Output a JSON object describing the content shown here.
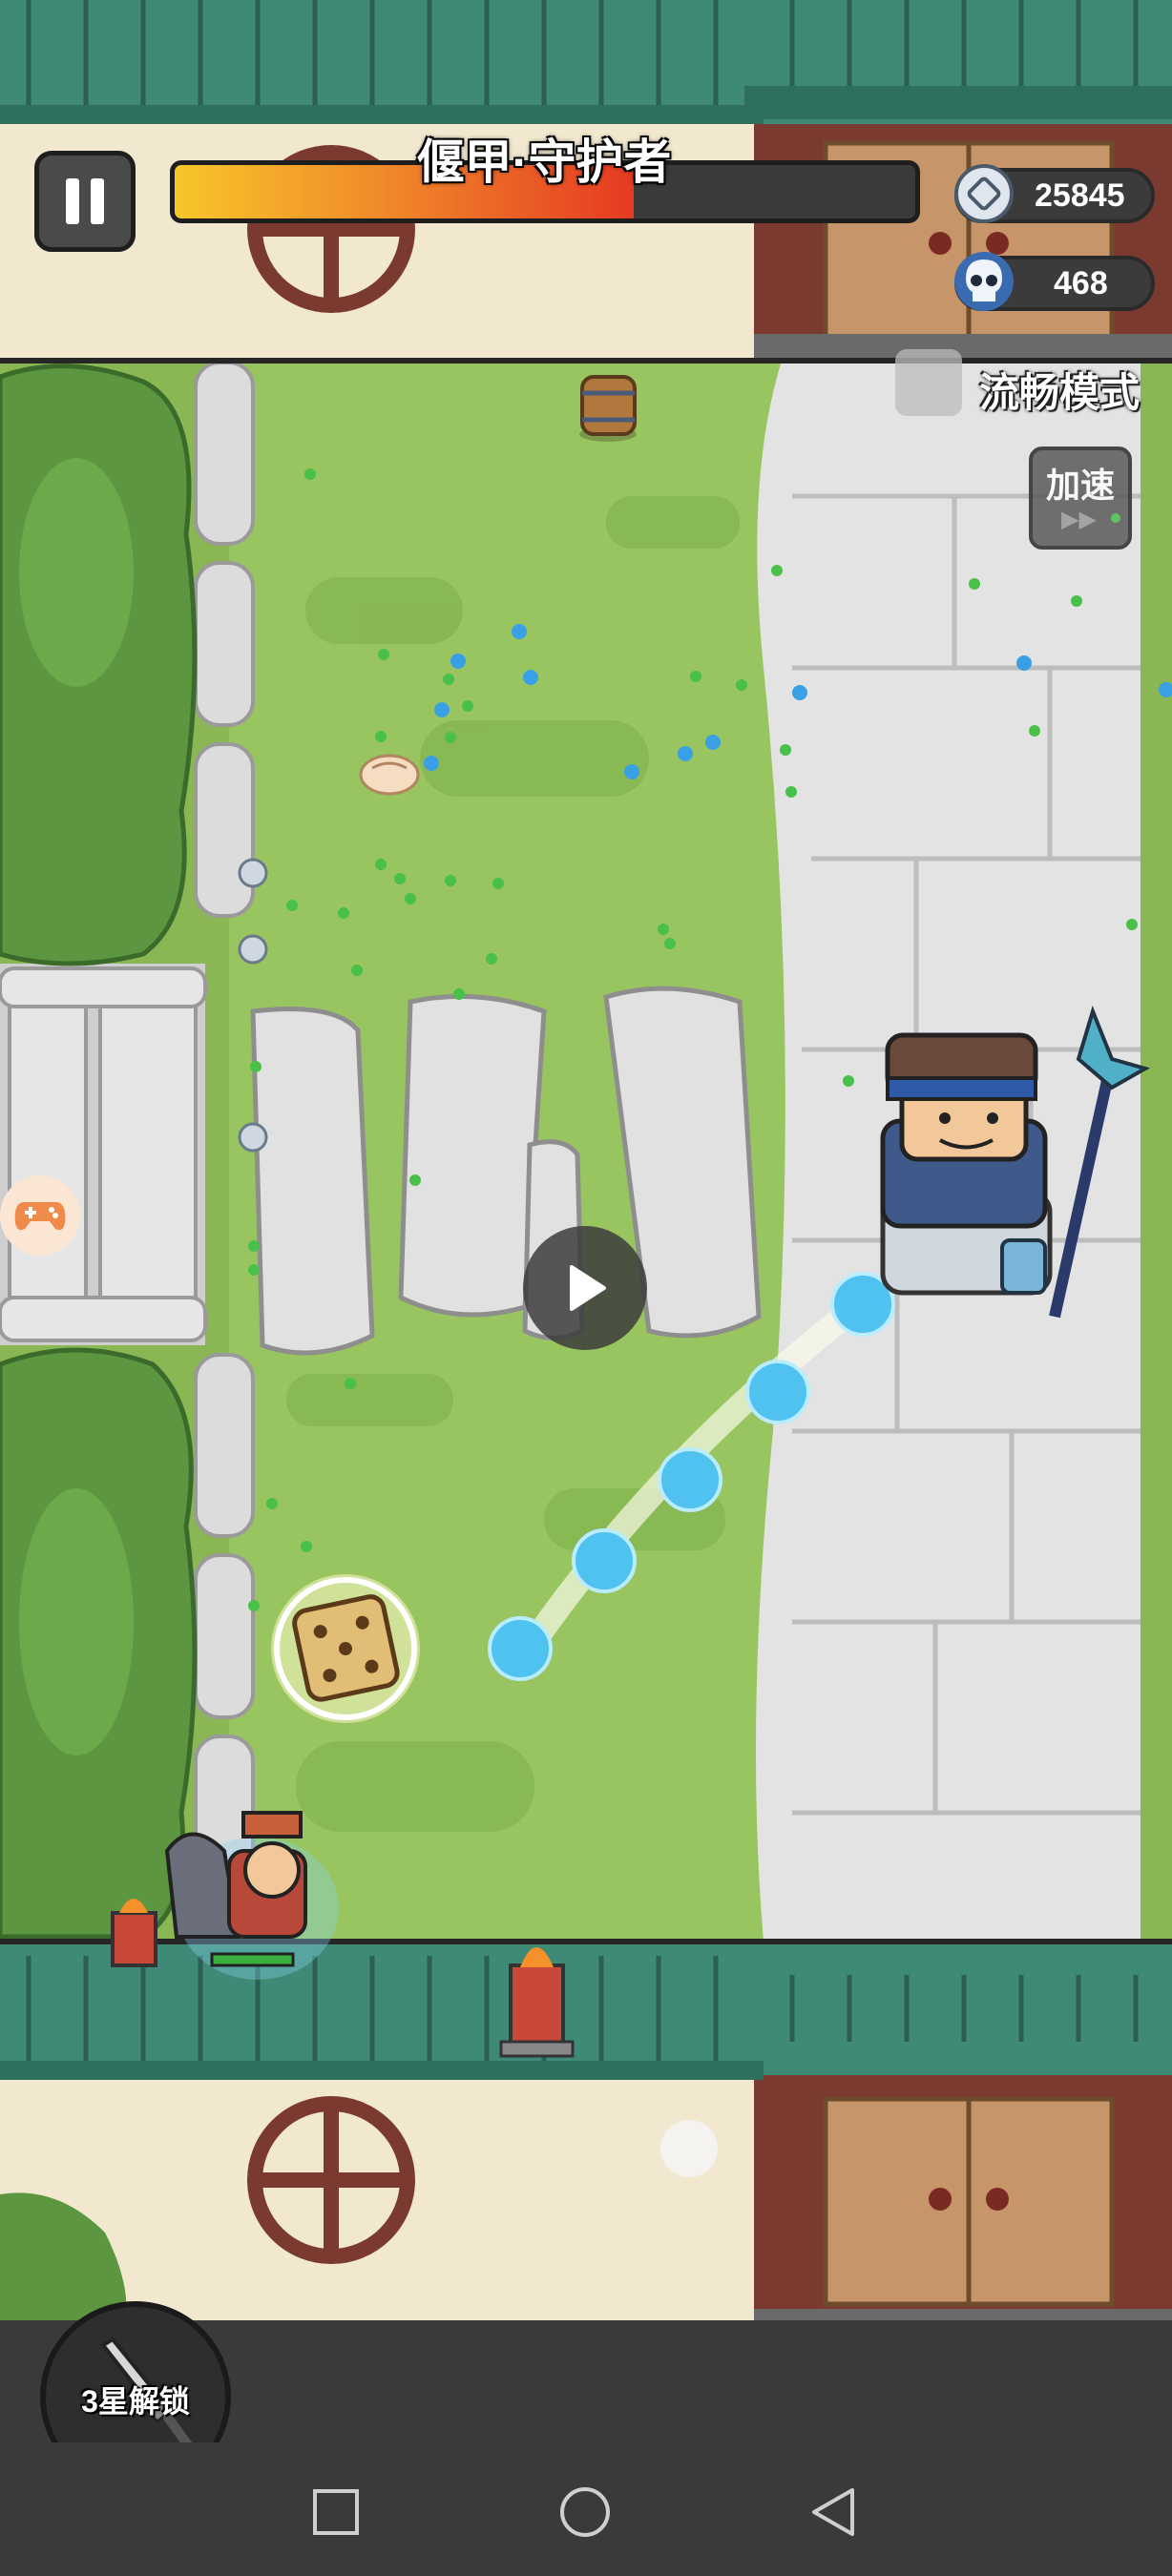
{
  "hud": {
    "boss_name": "偃甲·守护者",
    "boss_health_fraction": 0.62,
    "coins": "25845",
    "kills": "468"
  },
  "settings": {
    "smooth_mode_label": "流畅模式",
    "speed_label": "加速",
    "speed_arrows": "▶▶"
  },
  "skill": {
    "unlock_label": "3星解锁"
  },
  "colors": {
    "grass": "#98c55f",
    "stone": "#e1e1e1",
    "roof": "#3f8a76",
    "health_fill": "#e8742a",
    "projectile": "#4fc2ef"
  },
  "icons": {
    "pause": "pause-icon",
    "coin": "silver-coin-icon",
    "skull": "skull-icon",
    "play": "play-icon",
    "gamepad": "gamepad-icon",
    "sword": "sword-icon"
  }
}
